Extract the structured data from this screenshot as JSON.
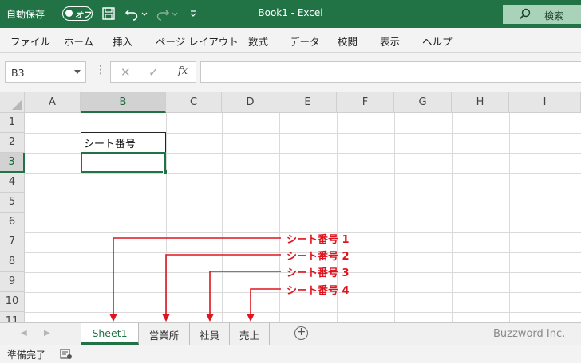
{
  "titlebar": {
    "autosave_label": "自動保存",
    "autosave_state": "オフ",
    "document_title": "Book1  -  Excel",
    "search_label": "検索",
    "color": "#217346"
  },
  "ribbon_tabs": [
    "ファイル",
    "ホーム",
    "挿入",
    "ページ レイアウト",
    "数式",
    "データ",
    "校閲",
    "表示",
    "ヘルプ"
  ],
  "formula_bar": {
    "name_box": "B3",
    "fx_label": "fx",
    "formula": ""
  },
  "grid": {
    "columns": [
      "A",
      "B",
      "C",
      "D",
      "E",
      "F",
      "G",
      "H",
      "I"
    ],
    "rows": [
      "1",
      "2",
      "3",
      "4",
      "5",
      "6",
      "7",
      "8",
      "9",
      "10",
      "11"
    ],
    "selected_column": "B",
    "selected_row": "3",
    "cells": {
      "B2": "シート番号",
      "B3": ""
    }
  },
  "annotations": [
    {
      "label": "シート番号 1",
      "target": "Sheet1"
    },
    {
      "label": "シート番号 2",
      "target": "営業所"
    },
    {
      "label": "シート番号 3",
      "target": "社員"
    },
    {
      "label": "シート番号 4",
      "target": "売上"
    }
  ],
  "annotation_color": "#e0141e",
  "sheet_tabs": [
    {
      "name": "Sheet1",
      "active": true
    },
    {
      "name": "営業所",
      "active": false
    },
    {
      "name": "社員",
      "active": false
    },
    {
      "name": "売上",
      "active": false
    }
  ],
  "add_sheet_symbol": "+",
  "watermark": "Buzzword Inc.",
  "status": {
    "text": "準備完了"
  }
}
